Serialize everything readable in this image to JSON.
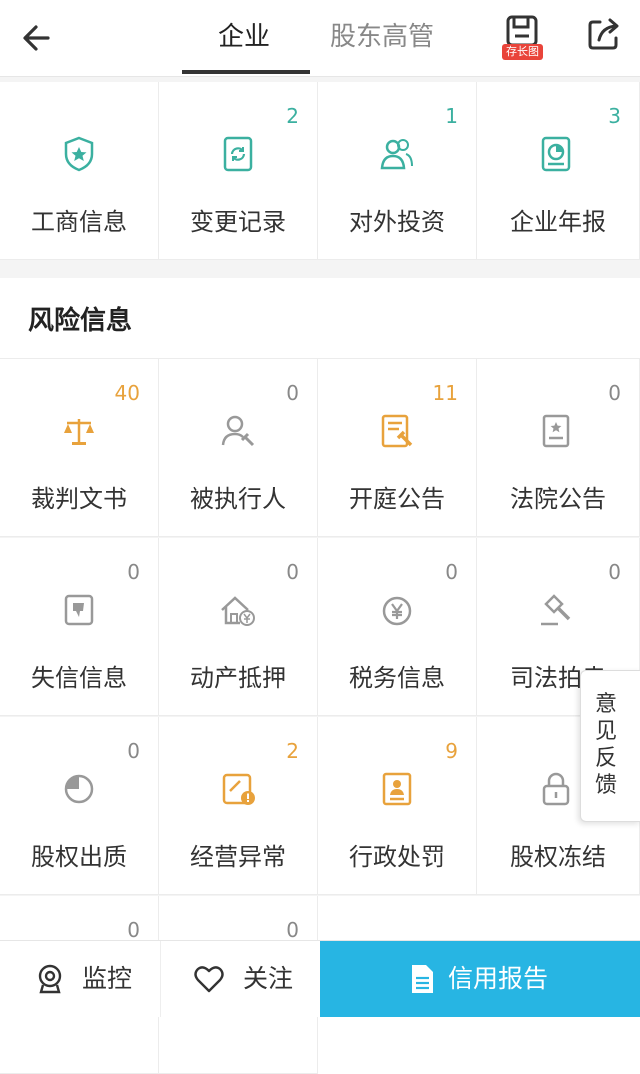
{
  "header": {
    "tabs": [
      {
        "label": "企业",
        "active": true
      },
      {
        "label": "股东高管",
        "active": false
      }
    ],
    "save_badge": "存长图"
  },
  "top_grid": [
    {
      "label": "工商信息",
      "count": "",
      "icon": "shield-star-icon"
    },
    {
      "label": "变更记录",
      "count": "2",
      "icon": "refresh-doc-icon"
    },
    {
      "label": "对外投资",
      "count": "1",
      "icon": "people-icon"
    },
    {
      "label": "企业年报",
      "count": "3",
      "icon": "report-chart-icon"
    }
  ],
  "risk_section": {
    "title": "风险信息",
    "items": [
      {
        "label": "裁判文书",
        "count": "40",
        "tone": "orange",
        "icon": "scales-icon"
      },
      {
        "label": "被执行人",
        "count": "0",
        "tone": "gray",
        "icon": "person-gavel-icon"
      },
      {
        "label": "开庭公告",
        "count": "11",
        "tone": "orange",
        "icon": "notice-gavel-icon"
      },
      {
        "label": "法院公告",
        "count": "0",
        "tone": "gray",
        "icon": "court-notice-icon"
      },
      {
        "label": "失信信息",
        "count": "0",
        "tone": "gray",
        "icon": "thumbs-down-icon"
      },
      {
        "label": "动产抵押",
        "count": "0",
        "tone": "gray",
        "icon": "house-yen-icon"
      },
      {
        "label": "税务信息",
        "count": "0",
        "tone": "gray",
        "icon": "tax-yen-icon"
      },
      {
        "label": "司法拍卖",
        "count": "0",
        "tone": "gray",
        "icon": "auction-gavel-icon"
      },
      {
        "label": "股权出质",
        "count": "0",
        "tone": "gray",
        "icon": "pie-icon"
      },
      {
        "label": "经营异常",
        "count": "2",
        "tone": "orange",
        "icon": "warning-doc-icon"
      },
      {
        "label": "行政处罚",
        "count": "9",
        "tone": "orange",
        "icon": "penalty-doc-icon"
      },
      {
        "label": "股权冻结",
        "count": "",
        "tone": "gray",
        "icon": "lock-icon"
      },
      {
        "label": "",
        "count": "0",
        "tone": "gray",
        "icon": ""
      },
      {
        "label": "",
        "count": "0",
        "tone": "gray",
        "icon": ""
      }
    ]
  },
  "feedback": {
    "label": "意见反馈"
  },
  "bottom_bar": {
    "monitor": "监控",
    "follow": "关注",
    "report": "信用报告"
  },
  "colors": {
    "teal": "#3bb0a0",
    "orange": "#e8a23c",
    "accent": "#27b5e3"
  }
}
